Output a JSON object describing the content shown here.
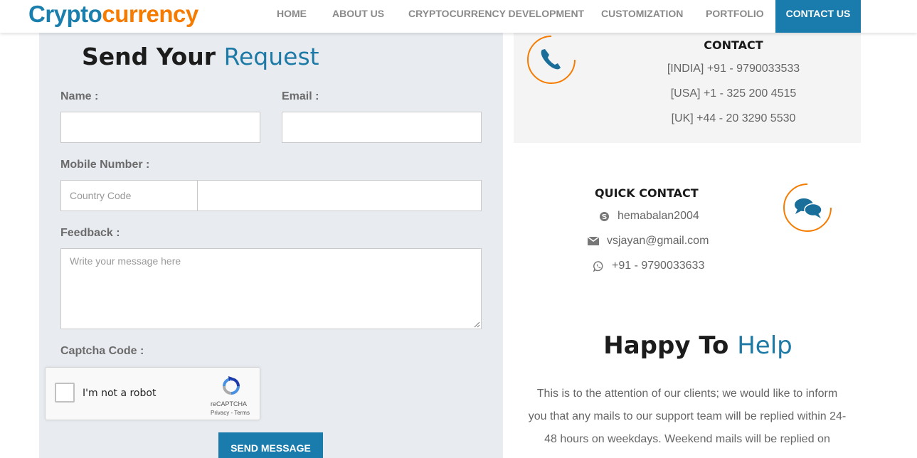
{
  "header": {
    "logo_part1": "Crypto",
    "logo_part2": "currency",
    "nav": [
      "HOME",
      "ABOUT US",
      "CRYPTOCURRENCY DEVELOPMENT",
      "CUSTOMIZATION",
      "PORTFOLIO",
      "CONTACT US"
    ],
    "active_nav": "CONTACT US"
  },
  "form": {
    "title_dark": "Send Your",
    "title_accent": "Request",
    "name_label": "Name :",
    "email_label": "Email :",
    "mobile_label": "Mobile Number :",
    "country_code_placeholder": "Country Code",
    "feedback_label": "Feedback :",
    "feedback_placeholder": "Write your message here",
    "captcha_label": "Captcha Code :",
    "recaptcha": {
      "label": "I'm not a robot",
      "brand": "reCAPTCHA",
      "links": "Privacy - Terms"
    },
    "send_button": "SEND MESSAGE"
  },
  "contact": {
    "title": "CONTACT",
    "lines": [
      "[INDIA] +91 - 9790033533",
      "[USA] +1 - 325 200 4515",
      "[UK] +44 - 20 3290 5530"
    ],
    "icon": "phone-icon"
  },
  "quick_contact": {
    "title": "QUICK CONTACT",
    "skype": "hemabalan2004",
    "email": "vsjayan@gmail.com",
    "whatsapp": "+91 - 9790033633",
    "icon": "chat-bubbles-icon"
  },
  "help": {
    "title_dark": "Happy To",
    "title_accent": "Help",
    "text": "This is to the attention of our clients; we would like to inform you that any mails to our support team will be replied within 24-48 hours on weekdays. Weekend mails will be replied on"
  },
  "colors": {
    "brand_blue": "#1a7cad",
    "brand_orange": "#f57c00"
  }
}
